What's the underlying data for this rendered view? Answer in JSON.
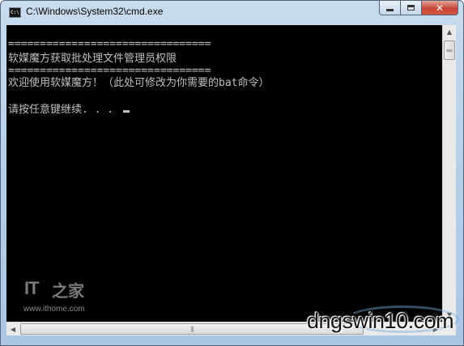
{
  "window": {
    "title": "C:\\Windows\\System32\\cmd.exe",
    "icon": "cmd-icon",
    "icon_text": "C:\\"
  },
  "caption_buttons": {
    "minimize": "minimize-icon",
    "maximize": "maximize-icon",
    "close": "✕"
  },
  "console": {
    "lines": [
      "================================",
      "软媒魔方获取批处理文件管理员权限",
      "================================",
      "欢迎使用软媒魔方！（此处可修改为你需要的bat命令）",
      "请按任意键继续. . . "
    ],
    "background": "#000000",
    "text_color": "#c0c0c0"
  },
  "scrollbars": {
    "up_arrow": "▲",
    "down_arrow": "▼",
    "left_arrow": "◀",
    "right_arrow": "▶",
    "grip": "|||"
  },
  "watermarks": {
    "it": "IT",
    "it_cn": "之家",
    "ithome": "www.ithome.com",
    "dngswin": "dngswin10.com"
  }
}
